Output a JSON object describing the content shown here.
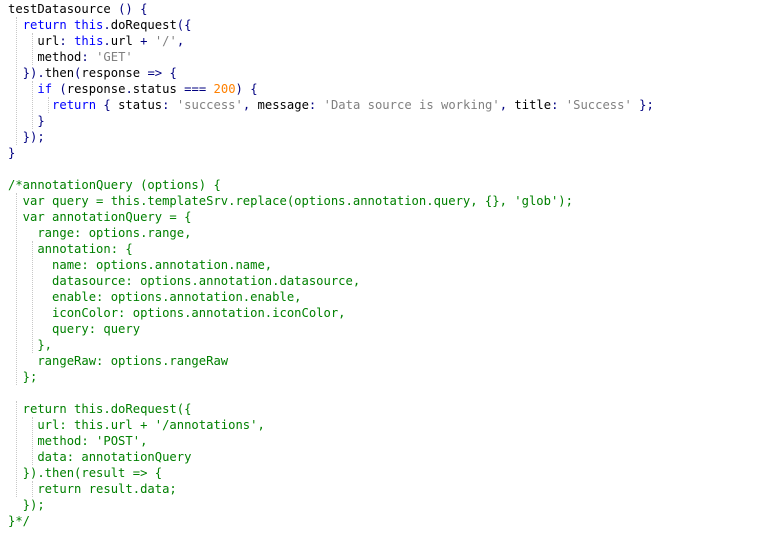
{
  "editor": {
    "colors": {
      "background": "#ffffff",
      "keyword": "#0000ff",
      "string": "#808080",
      "number": "#ff8000",
      "comment": "#008000",
      "punctuation": "#000080",
      "identifier": "#000000"
    },
    "lines": [
      [
        [
          "id",
          "testDatasource "
        ],
        [
          "pun",
          "() {"
        ]
      ],
      [
        [
          "id",
          "  "
        ],
        [
          "kw",
          "return this"
        ],
        [
          "pun",
          "."
        ],
        [
          "id",
          "doRequest"
        ],
        [
          "pun",
          "({"
        ]
      ],
      [
        [
          "id",
          "    url"
        ],
        [
          "pun",
          ": "
        ],
        [
          "kw",
          "this"
        ],
        [
          "pun",
          "."
        ],
        [
          "id",
          "url "
        ],
        [
          "pun",
          "+ "
        ],
        [
          "str",
          "'/'"
        ],
        [
          "pun",
          ","
        ]
      ],
      [
        [
          "id",
          "    method"
        ],
        [
          "pun",
          ": "
        ],
        [
          "str",
          "'GET'"
        ]
      ],
      [
        [
          "pun",
          "  })."
        ],
        [
          "id",
          "then"
        ],
        [
          "pun",
          "("
        ],
        [
          "id",
          "response "
        ],
        [
          "pun",
          "=> {"
        ]
      ],
      [
        [
          "id",
          "    "
        ],
        [
          "kw",
          "if"
        ],
        [
          "id",
          " "
        ],
        [
          "pun",
          "("
        ],
        [
          "id",
          "response"
        ],
        [
          "pun",
          "."
        ],
        [
          "id",
          "status "
        ],
        [
          "pun",
          "=== "
        ],
        [
          "num",
          "200"
        ],
        [
          "pun",
          ") {"
        ]
      ],
      [
        [
          "id",
          "      "
        ],
        [
          "kw",
          "return"
        ],
        [
          "id",
          " "
        ],
        [
          "pun",
          "{ "
        ],
        [
          "id",
          "status"
        ],
        [
          "pun",
          ": "
        ],
        [
          "str",
          "'success'"
        ],
        [
          "pun",
          ", "
        ],
        [
          "id",
          "message"
        ],
        [
          "pun",
          ": "
        ],
        [
          "str",
          "'Data source is working'"
        ],
        [
          "pun",
          ", "
        ],
        [
          "id",
          "title"
        ],
        [
          "pun",
          ": "
        ],
        [
          "str",
          "'Success'"
        ],
        [
          "pun",
          " };"
        ]
      ],
      [
        [
          "pun",
          "    }"
        ]
      ],
      [
        [
          "pun",
          "  });"
        ]
      ],
      [
        [
          "pun",
          "}"
        ]
      ],
      [
        [
          "id",
          ""
        ]
      ],
      [
        [
          "cmt",
          "/*annotationQuery (options) {"
        ]
      ],
      [
        [
          "cmt",
          "  var query = this.templateSrv.replace(options.annotation.query, {}, 'glob');"
        ]
      ],
      [
        [
          "cmt",
          "  var annotationQuery = {"
        ]
      ],
      [
        [
          "cmt",
          "    range: options.range,"
        ]
      ],
      [
        [
          "cmt",
          "    annotation: {"
        ]
      ],
      [
        [
          "cmt",
          "      name: options.annotation.name,"
        ]
      ],
      [
        [
          "cmt",
          "      datasource: options.annotation.datasource,"
        ]
      ],
      [
        [
          "cmt",
          "      enable: options.annotation.enable,"
        ]
      ],
      [
        [
          "cmt",
          "      iconColor: options.annotation.iconColor,"
        ]
      ],
      [
        [
          "cmt",
          "      query: query"
        ]
      ],
      [
        [
          "cmt",
          "    },"
        ]
      ],
      [
        [
          "cmt",
          "    rangeRaw: options.rangeRaw"
        ]
      ],
      [
        [
          "cmt",
          "  };"
        ]
      ],
      [
        [
          "id",
          ""
        ]
      ],
      [
        [
          "cmt",
          "  return this.doRequest({"
        ]
      ],
      [
        [
          "cmt",
          "    url: this.url + '/annotations',"
        ]
      ],
      [
        [
          "cmt",
          "    method: 'POST',"
        ]
      ],
      [
        [
          "cmt",
          "    data: annotationQuery"
        ]
      ],
      [
        [
          "cmt",
          "  }).then(result => {"
        ]
      ],
      [
        [
          "cmt",
          "    return result.data;"
        ]
      ],
      [
        [
          "cmt",
          "  });"
        ]
      ],
      [
        [
          "cmt",
          "}*/"
        ]
      ]
    ]
  }
}
